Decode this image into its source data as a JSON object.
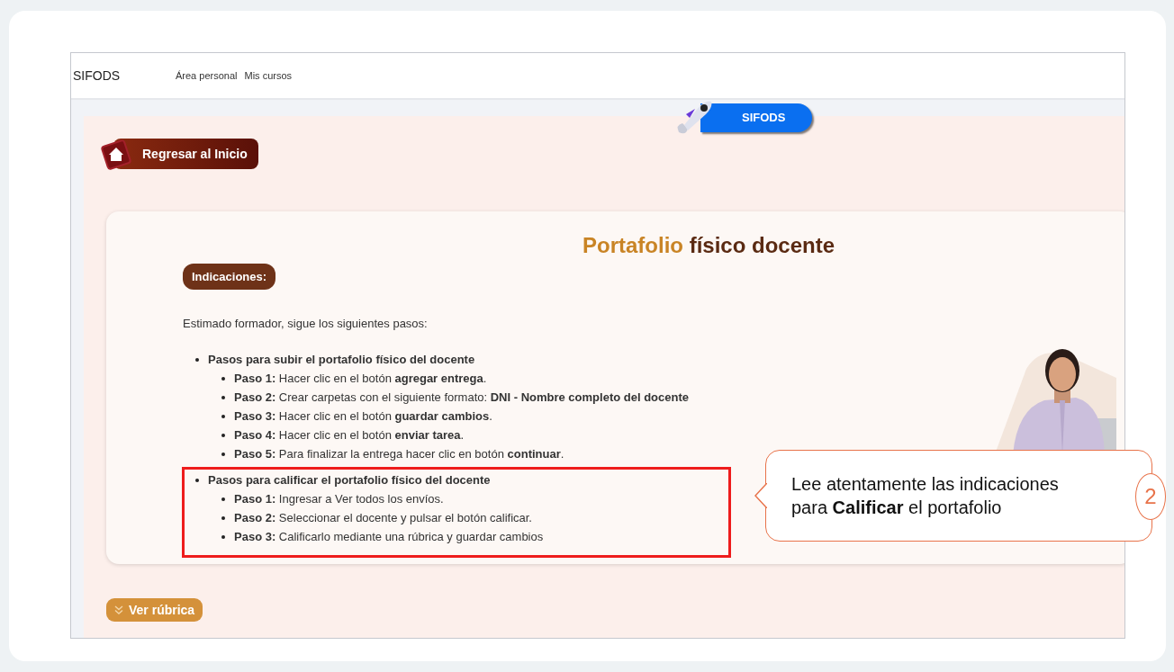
{
  "topbar": {
    "brand": "SIFODS",
    "links": [
      "Área personal",
      "Mis cursos"
    ]
  },
  "badge": {
    "label": "SIFODS"
  },
  "back_button": {
    "label": "Regresar al Inicio"
  },
  "title": {
    "highlight": "Portafolio",
    "rest": "físico docente"
  },
  "instructions_label": "Indicaciones:",
  "intro": "Estimado formador, sigue los siguientes pasos:",
  "sections": [
    {
      "heading": "Pasos para subir el portafolio físico del docente",
      "highlighted": false,
      "steps": [
        "**Paso 1:** Hacer clic en el botón **agregar entrega**.",
        "**Paso 2:** Crear carpetas con el siguiente formato: **DNI - Nombre completo del docente**",
        "**Paso 3:** Hacer clic en el botón **guardar cambios**.",
        "**Paso 4:** Hacer clic en el botón **enviar tarea**.",
        "**Paso 5:** Para finalizar la entrega hacer clic en botón **continuar**."
      ]
    },
    {
      "heading": "Pasos para calificar el portafolio físico del docente",
      "highlighted": true,
      "steps": [
        "**Paso 1:** Ingresar a Ver todos los envíos.",
        "**Paso 2:** Seleccionar el docente y pulsar el botón calificar.",
        "**Paso 3:** Calificarlo mediante una rúbrica y guardar cambios"
      ]
    }
  ],
  "rubric_button": {
    "label": "Ver rúbrica"
  },
  "callout": {
    "text": "Lee atentamente las indicaciones para **Calificar** el portafolio",
    "number": "2"
  }
}
